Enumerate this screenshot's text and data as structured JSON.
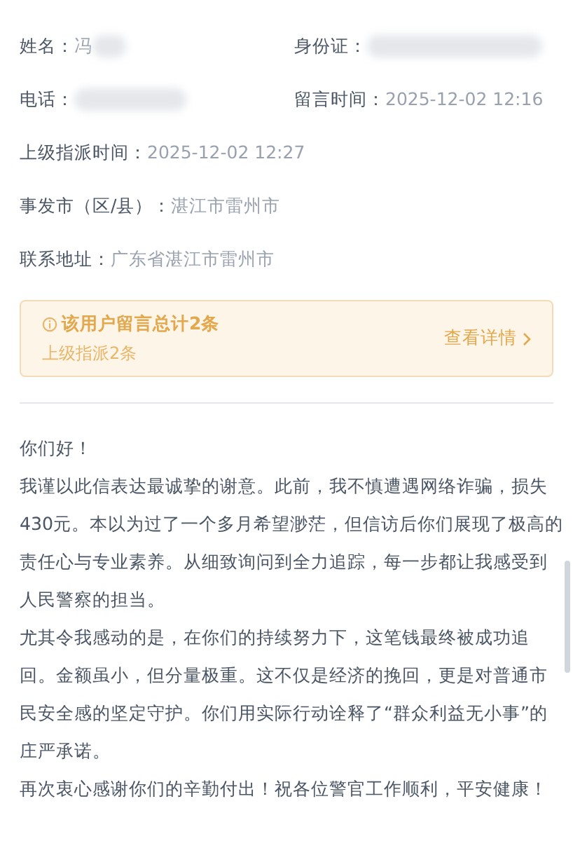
{
  "info_rows": [
    [
      {
        "label": "姓名：",
        "value": "冯",
        "redacted": true
      },
      {
        "label": "身份证：",
        "redacted": true
      }
    ],
    [
      {
        "label": "电话：",
        "redacted": true
      },
      {
        "label": "留言时间：",
        "value": "2025-12-02 12:16",
        "redacted": false
      }
    ],
    [
      {
        "label": "上级指派时间：",
        "value": "2025-12-02 12:27",
        "redacted": false
      }
    ],
    [
      {
        "label": "事发市（区/县）：",
        "value": "湛江市雷州市",
        "redacted": false
      }
    ],
    [
      {
        "label": "联系地址：",
        "value": "广东省湛江市雷州市",
        "redacted": false
      }
    ]
  ],
  "notice": {
    "title": "该用户留言总计2条",
    "subtitle": "上级指派2条",
    "link": "查看详情"
  },
  "message": [
    "你们好！",
    "我谨以此信表达最诚挚的谢意。此前，我不慎遭遇网络诈骗，损失430元。本以为过了一个多月希望渺茫，但信访后你们展现了极高的责任心与专业素养。从细致询问到全力追踪，每一步都让我感受到人民警察的担当。",
    "尤其令我感动的是，在你们的持续努力下，这笔钱最终被成功追回。金额虽小，但分量极重。这不仅是经济的挽回，更是对普通市民安全感的坚定守护。你们用实际行动诠释了“群众利益无小事”的庄严承诺。",
    "再次衷心感谢你们的辛勤付出！祝各位警官工作顺利，平安健康！"
  ]
}
